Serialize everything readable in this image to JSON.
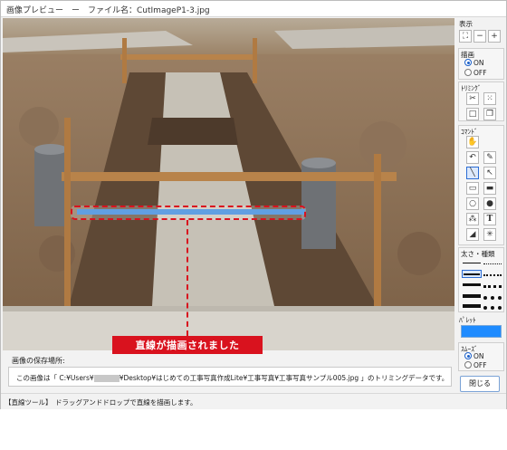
{
  "window": {
    "title": "画像プレビュー　ー　ファイル名：CutImageP1-3.jpg"
  },
  "annotation": {
    "text": "直線が描画されました"
  },
  "save_location": {
    "label": "画像の保存場所:",
    "prefix": "この画像は「 C:¥Users¥",
    "suffix": "¥Desktop¥はじめての工事写真作成Lite¥工事写真¥工事写真サンプル005.jpg 」のトリミングデータです。"
  },
  "status_bar": {
    "tool": "【直線ツール】",
    "hint": "ドラッグアンドドロップで直線を描画します。"
  },
  "panel": {
    "display": {
      "label": "表示",
      "buttons": [
        "fit-icon",
        "zoom-out-icon",
        "zoom-in-icon"
      ]
    },
    "drawing": {
      "label": "描画",
      "options": [
        "ON",
        "OFF"
      ],
      "selected": "ON"
    },
    "trimming": {
      "label": "ﾄﾘﾐﾝｸﾞ",
      "buttons": [
        "scissors-icon",
        "crop-dashed-icon",
        "square-icon",
        "copy-icon"
      ]
    },
    "commands": {
      "label": "ｺﾏﾝﾄﾞ",
      "buttons": [
        "hand-icon",
        "undo-icon",
        "eyedropper-icon",
        "line-icon",
        "arrow-icon",
        "rectangle-icon",
        "filled-rectangle-icon",
        "ellipse-icon",
        "filled-ellipse-icon",
        "stamp-icon",
        "text-icon",
        "eraser-icon",
        "sparkle-icon"
      ],
      "selected": "line-icon",
      "text_tool_glyph": "T"
    },
    "line_style": {
      "label": "太さ・種類",
      "selected_row": 1
    },
    "palette": {
      "label": "ﾊﾟﾚｯﾄ",
      "color": "#1e8bff"
    },
    "smooth": {
      "label": "ｽﾑｰｽﾞ",
      "options": [
        "ON",
        "OFF"
      ],
      "selected": "ON"
    },
    "close_button": "閉じる"
  },
  "colors": {
    "accent_red": "#d9121e",
    "selection_blue": "#2b6cd4",
    "drawn_line": "#2d7fd8"
  }
}
